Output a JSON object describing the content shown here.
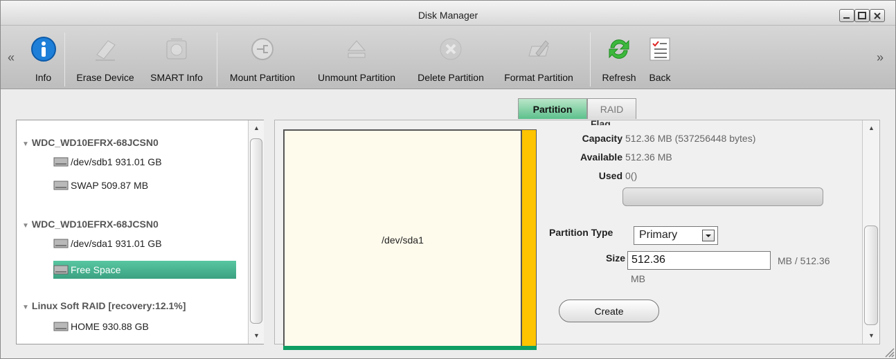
{
  "window": {
    "title": "Disk Manager"
  },
  "toolbar": {
    "buttons": [
      {
        "id": "info",
        "label": "Info",
        "icon": "info-icon",
        "enabled": true
      },
      {
        "id": "erase",
        "label": "Erase Device",
        "icon": "eraser-icon",
        "enabled": false
      },
      {
        "id": "smart",
        "label": "SMART Info",
        "icon": "disk-chip-icon",
        "enabled": false
      },
      {
        "id": "mount",
        "label": "Mount Partition",
        "icon": "plug-icon",
        "enabled": false
      },
      {
        "id": "unmount",
        "label": "Unmount Partition",
        "icon": "eject-icon",
        "enabled": false
      },
      {
        "id": "delete",
        "label": "Delete Partition",
        "icon": "delete-x-icon",
        "enabled": false
      },
      {
        "id": "format",
        "label": "Format Partition",
        "icon": "pencil-format-icon",
        "enabled": false
      },
      {
        "id": "refresh",
        "label": "Refresh",
        "icon": "refresh-icon",
        "enabled": true
      },
      {
        "id": "back",
        "label": "Back",
        "icon": "checklist-icon",
        "enabled": true
      }
    ]
  },
  "tabs": {
    "partition": "Partition",
    "raid": "RAID",
    "active": "Partition"
  },
  "tree": {
    "disk1": {
      "name": "WDC_WD10EFRX-68JCSN0",
      "parts": [
        "/dev/sdb1 931.01 GB",
        "SWAP 509.87 MB"
      ]
    },
    "disk2": {
      "name": "WDC_WD10EFRX-68JCSN0",
      "parts": [
        "/dev/sda1 931.01 GB",
        "Free Space"
      ]
    },
    "raid": {
      "name": "Linux Soft RAID [recovery:12.1%]",
      "parts": [
        "HOME 930.88 GB"
      ]
    },
    "selected": "Free Space"
  },
  "partition_map": {
    "label": "/dev/sda1"
  },
  "details": {
    "flag_label": "Flag",
    "capacity_label": "Capacity",
    "capacity_value": "512.36 MB (537256448 bytes)",
    "available_label": "Available",
    "available_value": "512.36 MB",
    "used_label": "Used",
    "used_value": "0()",
    "used_fraction": 0,
    "partition_type_label": "Partition Type",
    "partition_type_value": "Primary",
    "size_label": "Size",
    "size_value": "512.36",
    "size_suffix_1": "MB / 512.36",
    "size_suffix_2": "MB",
    "create_button": "Create"
  },
  "colors": {
    "accent_green": "#5cc08c",
    "free_space": "#ffc400",
    "map_underline": "#0e9e63"
  }
}
